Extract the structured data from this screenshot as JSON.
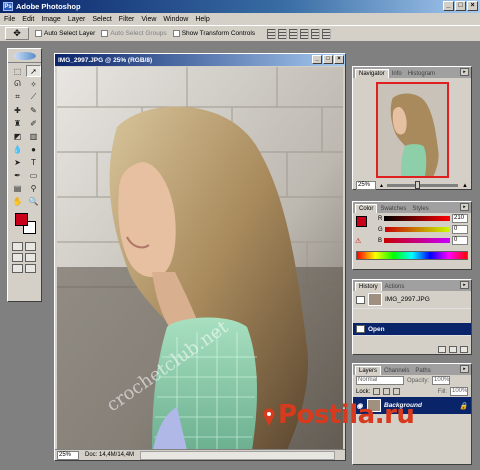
{
  "app": {
    "title": "Adobe Photoshop"
  },
  "menu": [
    "File",
    "Edit",
    "Image",
    "Layer",
    "Select",
    "Filter",
    "View",
    "Window",
    "Help"
  ],
  "options_bar": {
    "auto_select_layer": "Auto Select Layer",
    "auto_select_groups": "Auto Select Groups",
    "show_transform_controls": "Show Transform Controls"
  },
  "document": {
    "title": "IMG_2997.JPG @ 25% (RGB/8)",
    "zoom": "25%",
    "doc_size": "Doc: 14,4M/14,4M",
    "watermark_text": "crochetclub.net"
  },
  "navigator": {
    "tabs": [
      "Navigator",
      "Info",
      "Histogram"
    ],
    "zoom": "25%"
  },
  "color": {
    "tabs": [
      "Color",
      "Swatches",
      "Styles"
    ],
    "channels": [
      {
        "label": "R",
        "value": "210"
      },
      {
        "label": "G",
        "value": "0"
      },
      {
        "label": "B",
        "value": "0"
      }
    ],
    "foreground": "#c8001a"
  },
  "history": {
    "tabs": [
      "History",
      "Actions"
    ],
    "snapshot": "IMG_2997.JPG",
    "items": [
      {
        "label": "Open"
      }
    ]
  },
  "layers": {
    "tabs": [
      "Layers",
      "Channels",
      "Paths"
    ],
    "blend_mode": "Normal",
    "opacity_label": "Opacity:",
    "opacity": "100%",
    "lock_label": "Lock:",
    "fill_label": "Fill:",
    "fill": "100%",
    "layer_name": "Background"
  },
  "site_watermark": "Postila.ru"
}
